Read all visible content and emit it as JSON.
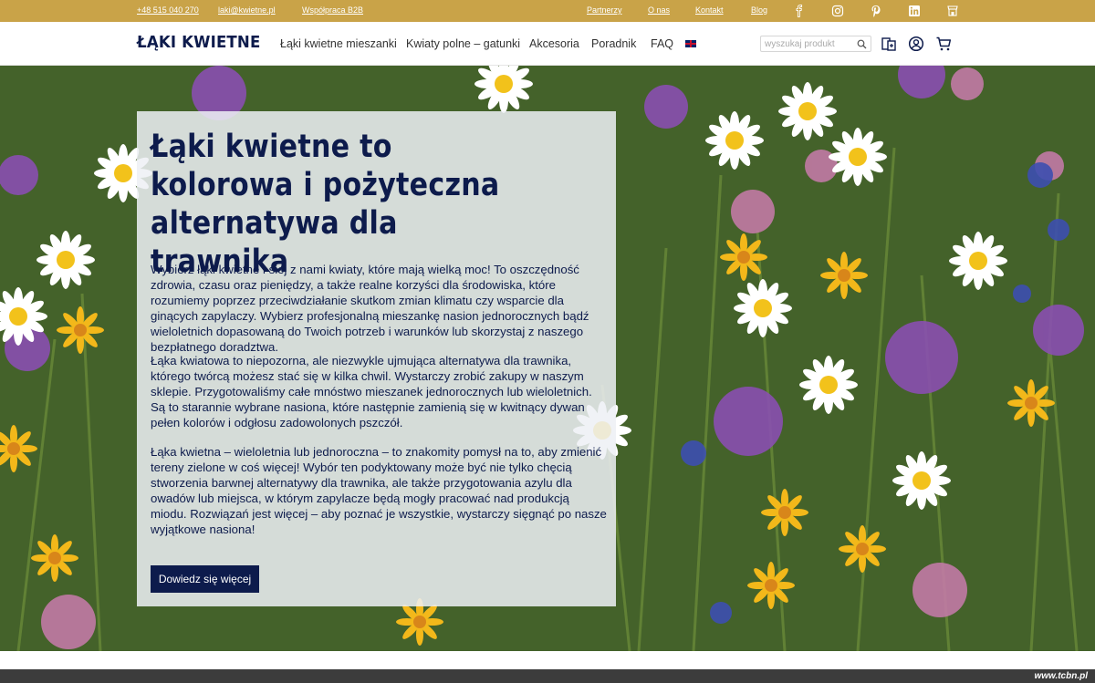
{
  "topbar": {
    "phone": "+48 515 040 270",
    "email": "laki@kwietne.pl",
    "b2b": "Współpraca B2B",
    "links": [
      "Partnerzy",
      "O nas",
      "Kontakt",
      "Blog"
    ],
    "social_icons": [
      "facebook-icon",
      "instagram-icon",
      "pinterest-icon",
      "linkedin-icon",
      "shop-icon"
    ],
    "background": "#c9a348"
  },
  "header": {
    "logo": "ŁĄKI KWIETNE",
    "nav": [
      "Łąki kwietne mieszanki",
      "Kwiaty polne – gatunki",
      "Akcesoria",
      "Poradnik",
      "FAQ"
    ],
    "language_icon": "uk-flag-icon",
    "search_placeholder": "wyszukaj produkt",
    "icons": [
      "compare-icon",
      "account-icon",
      "cart-icon"
    ]
  },
  "hero": {
    "title": "Łąki kwietne to kolorowa i pożyteczna alternatywa dla trawnika",
    "paragraphs": [
      "Wybierz łąki kwietne i siej z nami kwiaty, które mają wielką moc! To oszczędność zdrowia, czasu oraz pieniędzy, a także realne korzyści dla środowiska, które rozumiemy poprzez przeciwdziałanie skutkom zmian klimatu czy wsparcie dla ginących zapylaczy. Wybierz profesjonalną mieszankę nasion jednorocznych bądź wieloletnich dopasowaną do Twoich potrzeb i warunków lub skorzystaj z naszego bezpłatnego doradztwa.",
      "Łąka kwiatowa to niepozorna, ale niezwykle ujmująca alternatywa dla trawnika, którego twórcą możesz stać się w kilka chwil. Wystarczy zrobić zakupy w naszym sklepie. Przygotowaliśmy całe mnóstwo mieszanek jednorocznych lub wieloletnich. Są to starannie wybrane nasiona, które następnie zamienią się w kwitnący dywan pełen kolorów i odgłosu zadowolonych pszczół.",
      "Łąka kwietna – wieloletnia lub jednoroczna – to znakomity pomysł na to, aby zmienić tereny zielone w coś więcej! Wybór ten podyktowany może być nie tylko chęcią stworzenia barwnej alternatywy dla trawnika, ale także przygotowania azylu dla owadów lub miejsca, w którym zapylacze będą mogły pracować nad produkcją miodu. Rozwiązań jest więcej – aby poznać je wszystkie, wystarczy sięgnąć po nasze wyjątkowe nasiona!"
    ],
    "cta": "Dowiedz się więcej"
  },
  "watermark": "www.tcbn.pl",
  "colors": {
    "brand_navy": "#0d1b4c",
    "gold": "#c9a348"
  }
}
